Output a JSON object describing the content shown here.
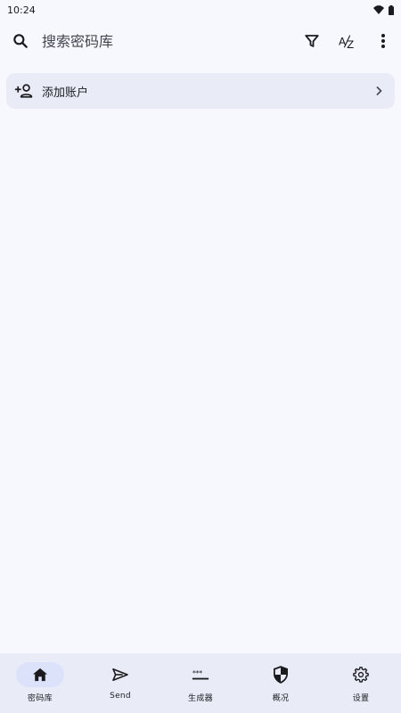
{
  "status_bar": {
    "time": "10:24",
    "icons": [
      "wifi-icon",
      "battery-icon"
    ]
  },
  "search": {
    "placeholder": "搜索密码库",
    "value": ""
  },
  "toolbar": {
    "icons": [
      "filter-icon",
      "sort-az-icon",
      "more-vert-icon"
    ]
  },
  "add_account": {
    "label": "添加账户",
    "icon": "person-add-icon"
  },
  "bottom_nav": {
    "items": [
      {
        "label": "密码库",
        "icon": "home-icon",
        "active": true
      },
      {
        "label": "Send",
        "icon": "send-icon",
        "active": false
      },
      {
        "label": "生成器",
        "icon": "password-generator-icon",
        "active": false
      },
      {
        "label": "概况",
        "icon": "shield-icon",
        "active": false
      },
      {
        "label": "设置",
        "icon": "gear-icon",
        "active": false
      }
    ]
  },
  "colors": {
    "background": "#f6f8fe",
    "surface": "#e9ecf7",
    "active_pill": "#dbe2fa",
    "text": "#1b1b1f"
  }
}
